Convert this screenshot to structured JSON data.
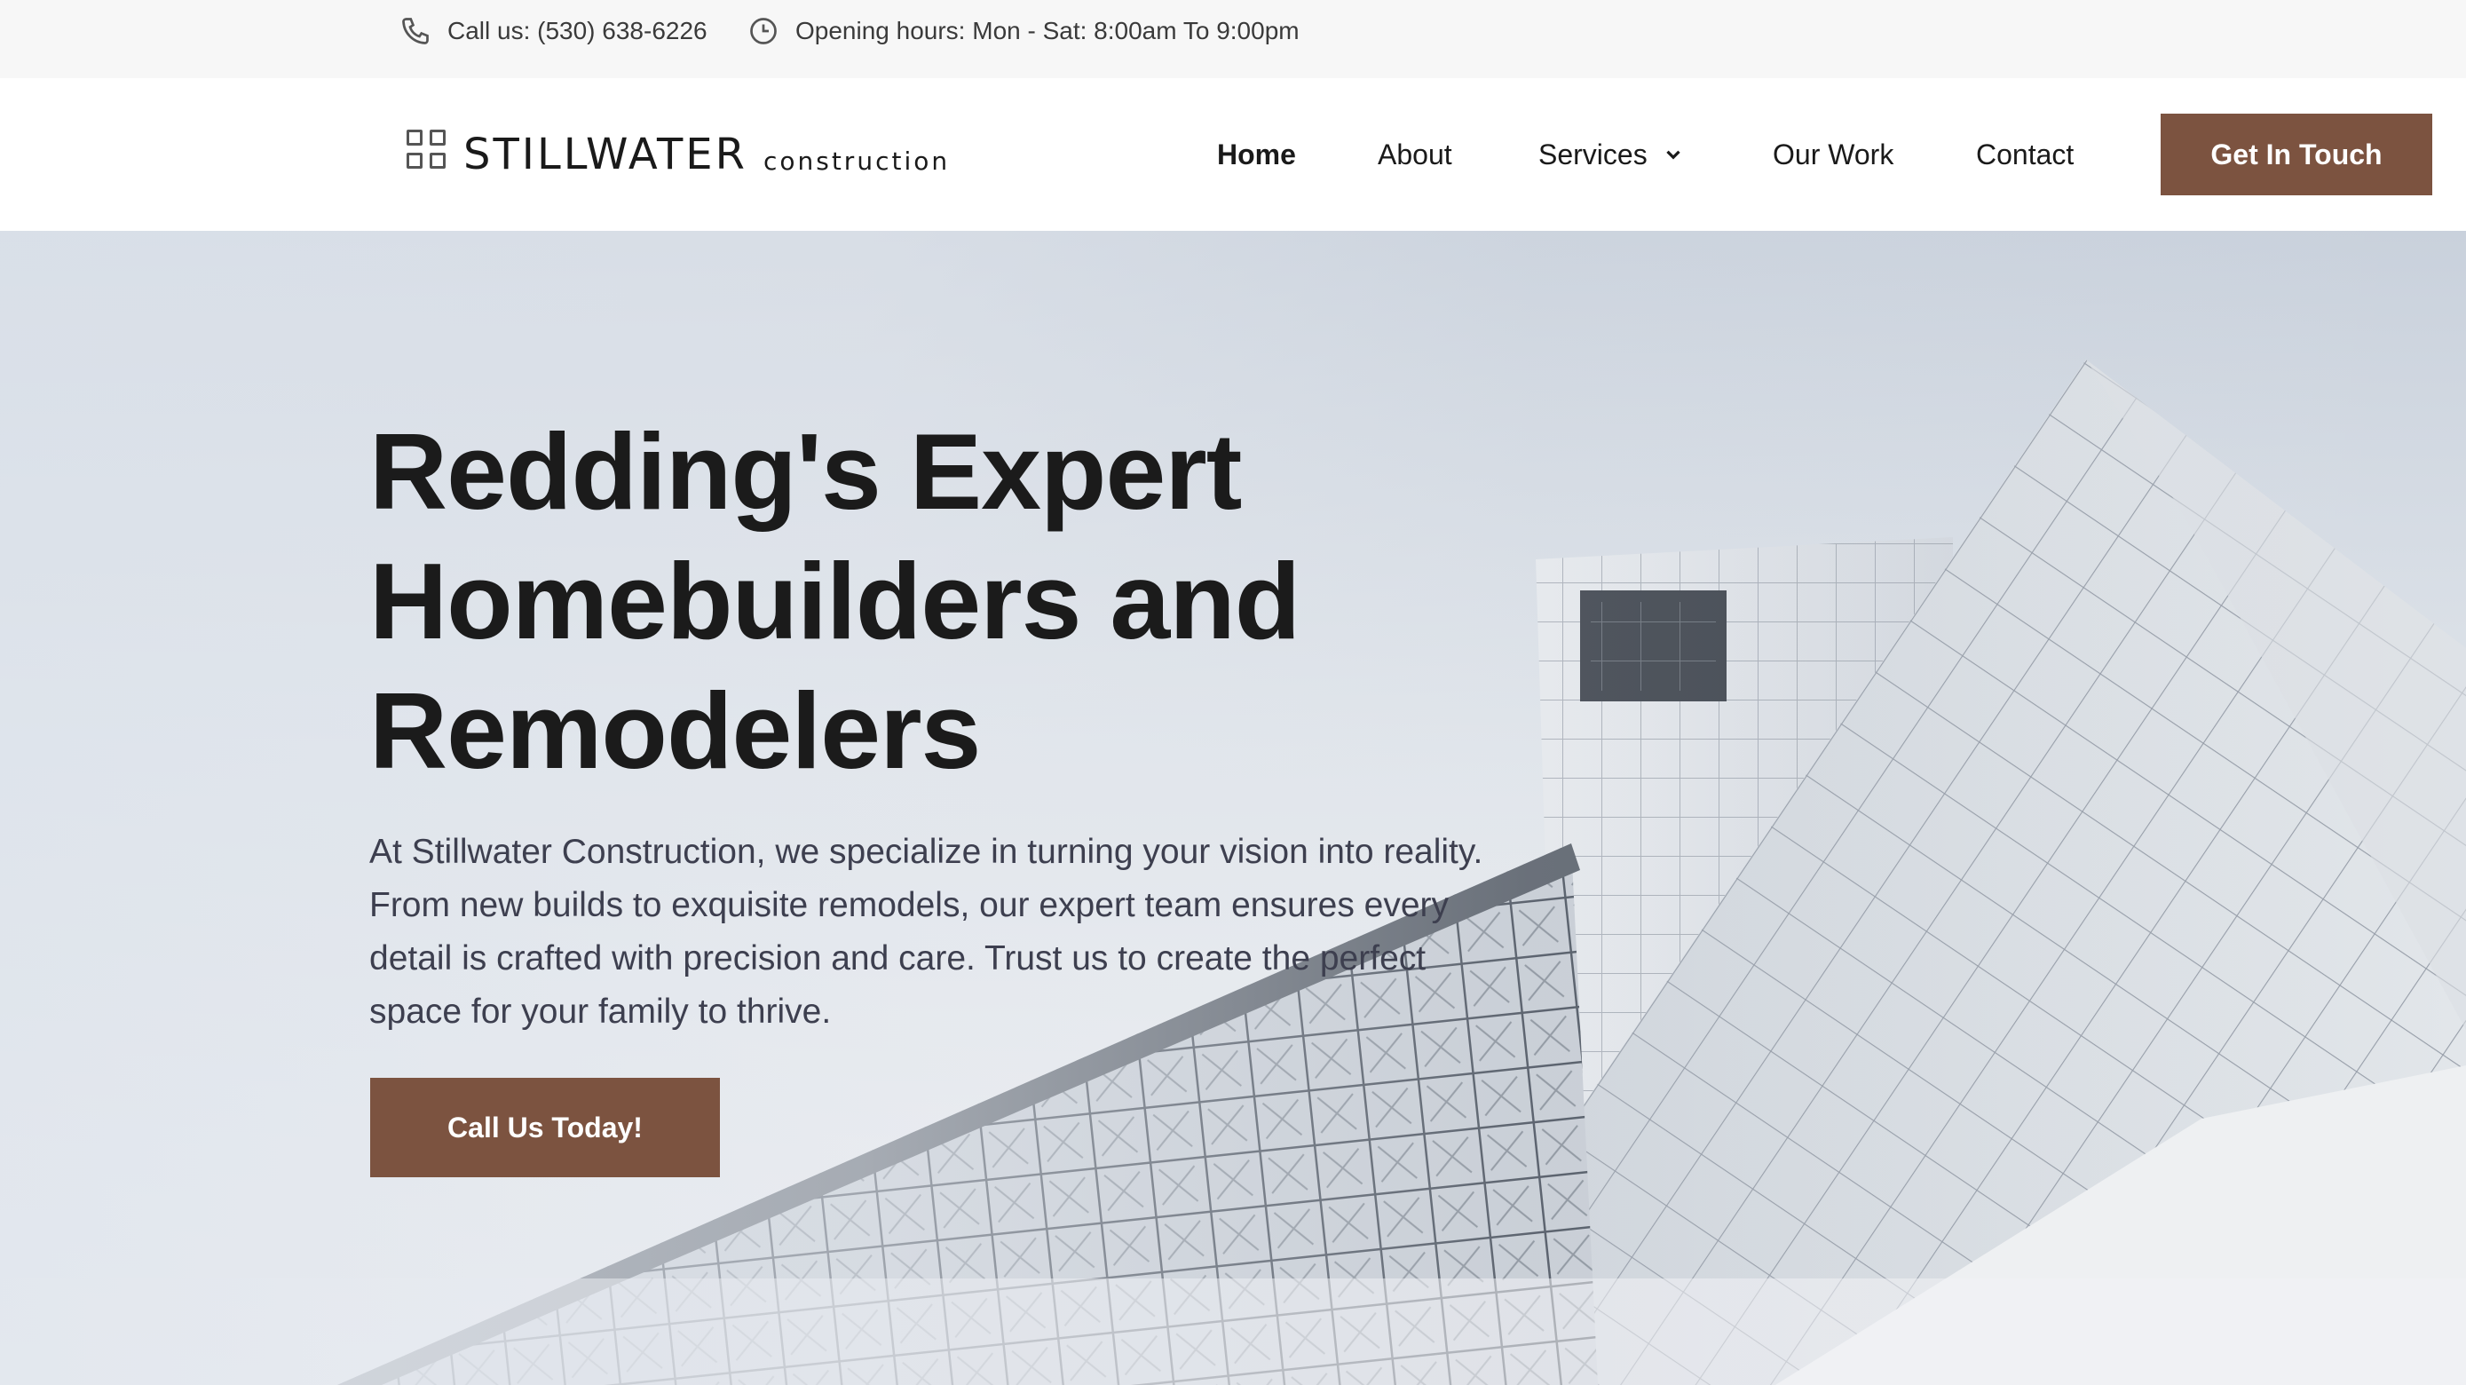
{
  "topbar": {
    "phone_icon": "phone-icon",
    "phone_text": "Call us: (530) 638-6226",
    "hours_icon": "clock-icon",
    "hours_text": "Opening hours: Mon - Sat: 8:00am To 9:00pm"
  },
  "header": {
    "logo_icon": "grid-icon",
    "logo_name": "STILLWATER",
    "logo_sub": "construction",
    "nav": {
      "home": "Home",
      "about": "About",
      "services": "Services",
      "our_work": "Our Work",
      "contact": "Contact"
    },
    "cta_label": "Get In Touch"
  },
  "hero": {
    "title_line1": "Redding's Expert",
    "title_line2": "Homebuilders and",
    "title_line3": "Remodelers",
    "description": "At Stillwater Construction, we specialize in turning your vision into reality. From new builds to exquisite remodels, our expert team ensures every detail is crafted with precision and care. Trust us to create the perfect space for your family to thrive.",
    "cta_label": "Call Us Today!"
  },
  "colors": {
    "accent": "#7c5340",
    "topbar_bg": "#f7f7f7",
    "text_dark": "#1b1b1b",
    "text_body": "#3d3f4f"
  }
}
